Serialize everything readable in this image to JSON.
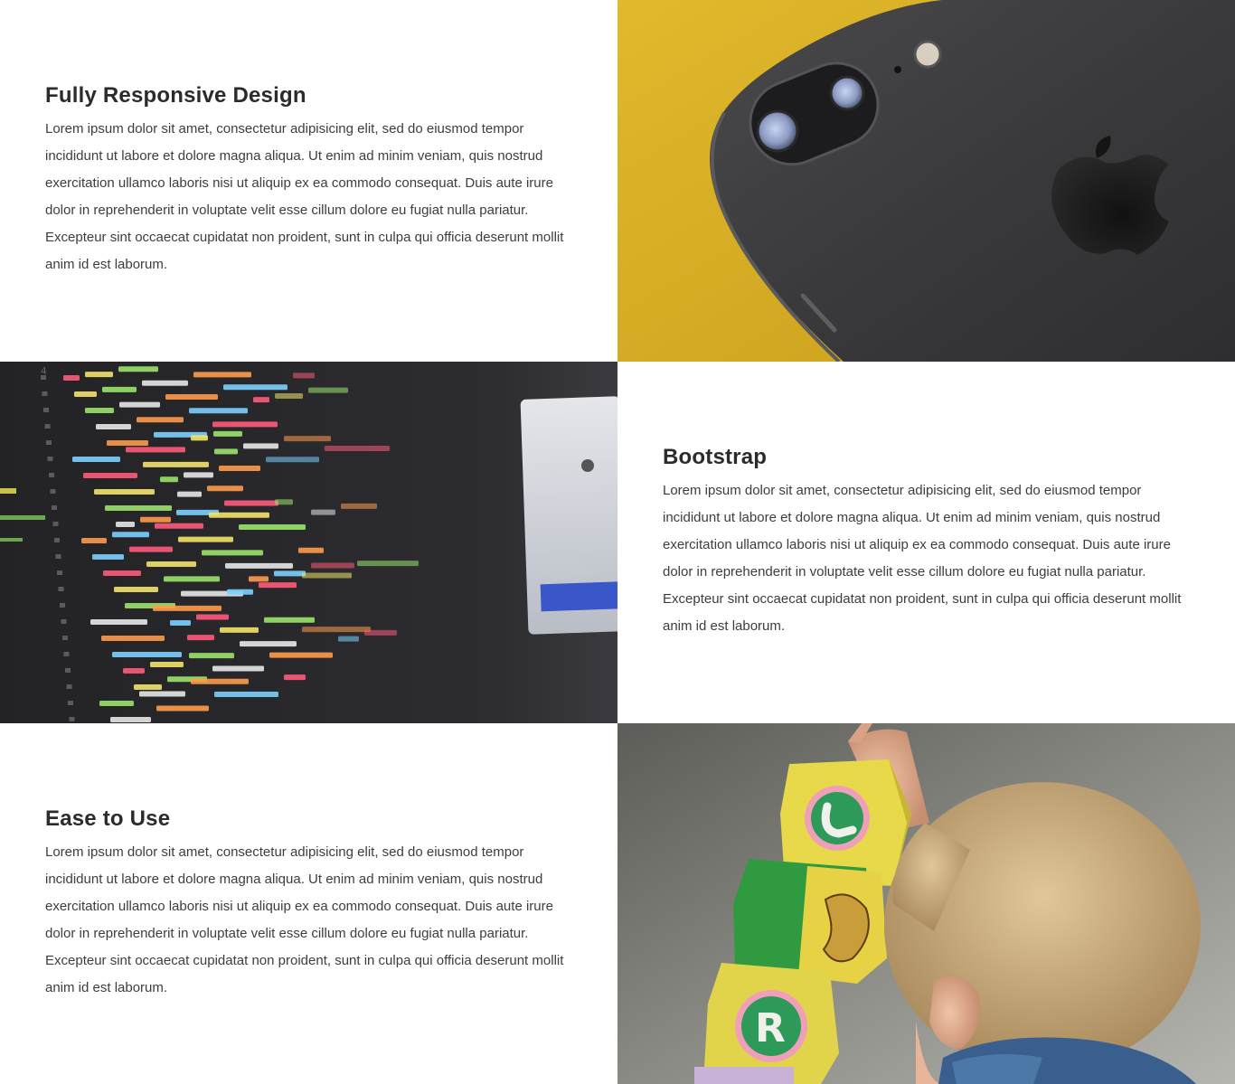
{
  "features": [
    {
      "title": "Fully Responsive Design",
      "text": "Lorem ipsum dolor sit amet, consectetur adipisicing elit, sed do eiusmod tempor incididunt ut labore et dolore magna aliqua. Ut enim ad minim veniam, quis nostrud exercitation ullamco laboris nisi ut aliquip ex ea commodo consequat. Duis aute irure dolor in reprehenderit in voluptate velit esse cillum dolore eu fugiat nulla pariatur. Excepteur sint occaecat cupidatat non proident, sunt in culpa qui officia deserunt mollit anim id est laborum.",
      "image": "phone-camera-photo"
    },
    {
      "title": "Bootstrap",
      "text": "Lorem ipsum dolor sit amet, consectetur adipisicing elit, sed do eiusmod tempor incididunt ut labore et dolore magna aliqua. Ut enim ad minim veniam, quis nostrud exercitation ullamco laboris nisi ut aliquip ex ea commodo consequat. Duis aute irure dolor in reprehenderit in voluptate velit esse cillum dolore eu fugiat nulla pariatur. Excepteur sint occaecat cupidatat non proident, sunt in culpa qui officia deserunt mollit anim id est laborum.",
      "image": "code-editor-photo"
    },
    {
      "title": "Ease to Use",
      "text": "Lorem ipsum dolor sit amet, consectetur adipisicing elit, sed do eiusmod tempor incididunt ut labore et dolore magna aliqua. Ut enim ad minim veniam, quis nostrud exercitation ullamco laboris nisi ut aliquip ex ea commodo consequat. Duis aute irure dolor in reprehenderit in voluptate velit esse cillum dolore eu fugiat nulla pariatur. Excepteur sint occaecat cupidatat non proident, sunt in culpa qui officia deserunt mollit anim id est laborum.",
      "image": "child-blocks-photo"
    }
  ],
  "colors": {
    "heading": "#2b2b2b",
    "body_text": "#3d3d3d",
    "phone_bg": "#d9b22a",
    "phone_body": "#3a3a3c",
    "code_bg": "#2b2b2e",
    "blocks_bg": "#8a8a84"
  }
}
